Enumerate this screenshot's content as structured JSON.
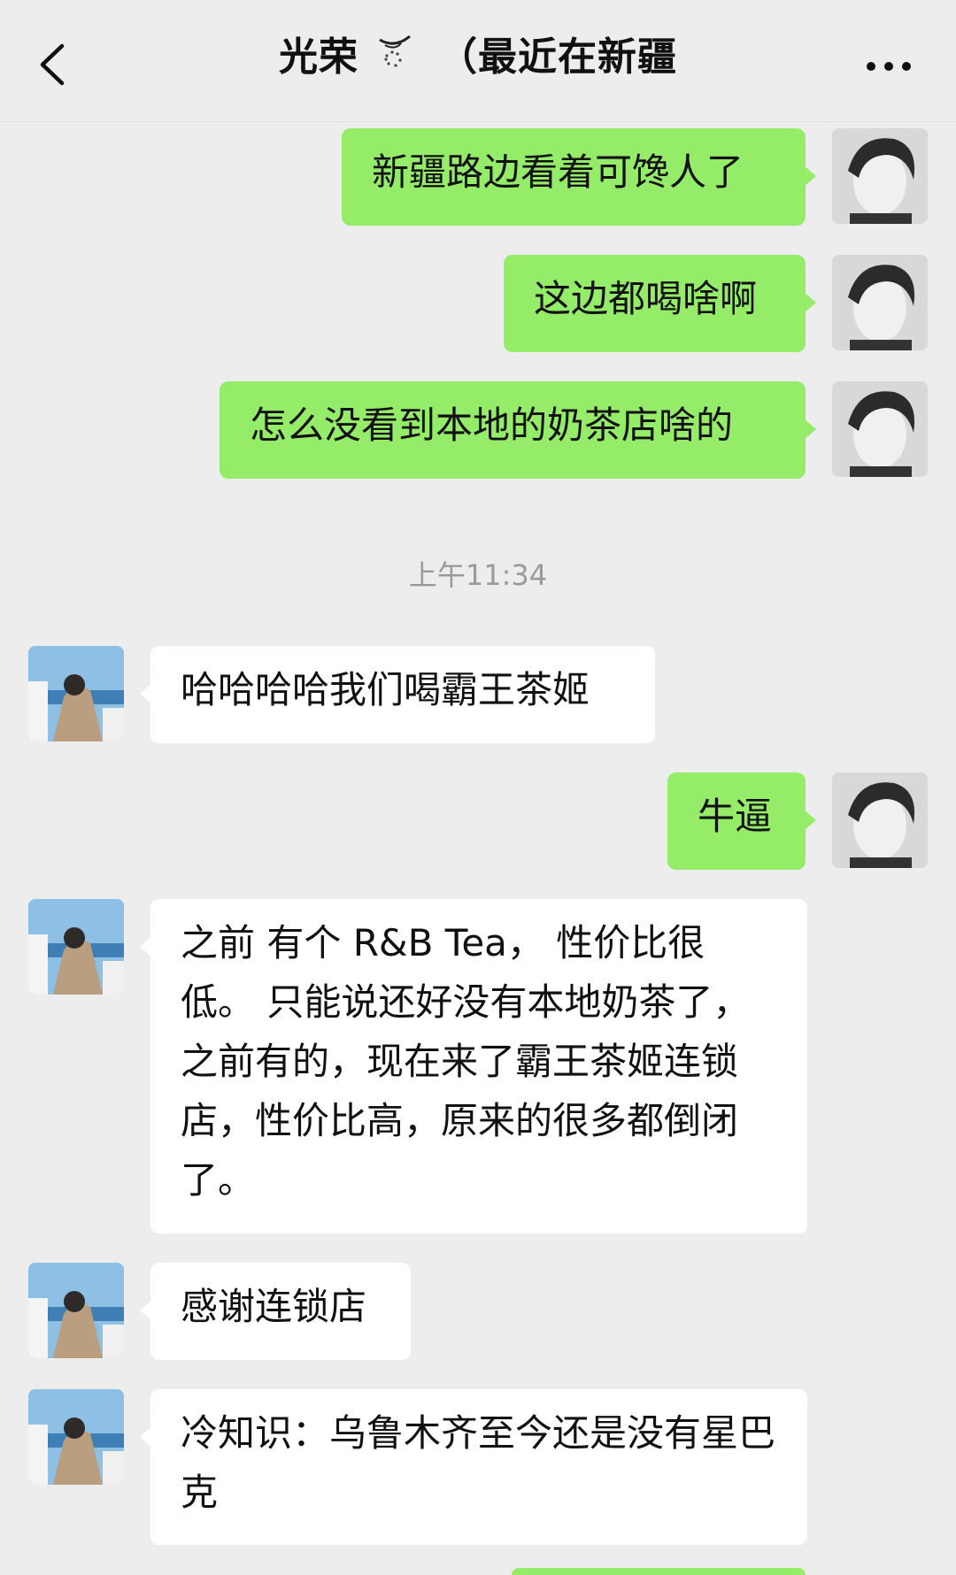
{
  "header": {
    "title": "光荣",
    "subtitle": "（最近在新疆"
  },
  "timestamp": "上午11:34",
  "messages": [
    {
      "from": "me",
      "text": "新疆路边看着可馋人了"
    },
    {
      "from": "me",
      "text": "这边都喝啥啊"
    },
    {
      "from": "me",
      "text": "怎么没看到本地的奶茶店啥的"
    },
    {
      "from": "friend",
      "text": "哈哈哈哈我们喝霸王茶姬"
    },
    {
      "from": "me",
      "text": "牛逼"
    },
    {
      "from": "friend",
      "text": "之前 有个 R&B Tea， 性价比很低。 只能说还好没有本地奶茶了，之前有的，现在来了霸王茶姬连锁店，性价比高，原来的很多都倒闭了。"
    },
    {
      "from": "friend",
      "text": "感谢连锁店"
    },
    {
      "from": "friend",
      "text": "冷知识：乌鲁木齐至今还是没有星巴克"
    }
  ],
  "colors": {
    "background": "#ededed",
    "my_bubble": "#95ec69",
    "friend_bubble": "#ffffff"
  },
  "icons": {
    "back": "chevron-left-icon",
    "more": "more-dots-icon",
    "title_decoration": "seal-icon"
  }
}
